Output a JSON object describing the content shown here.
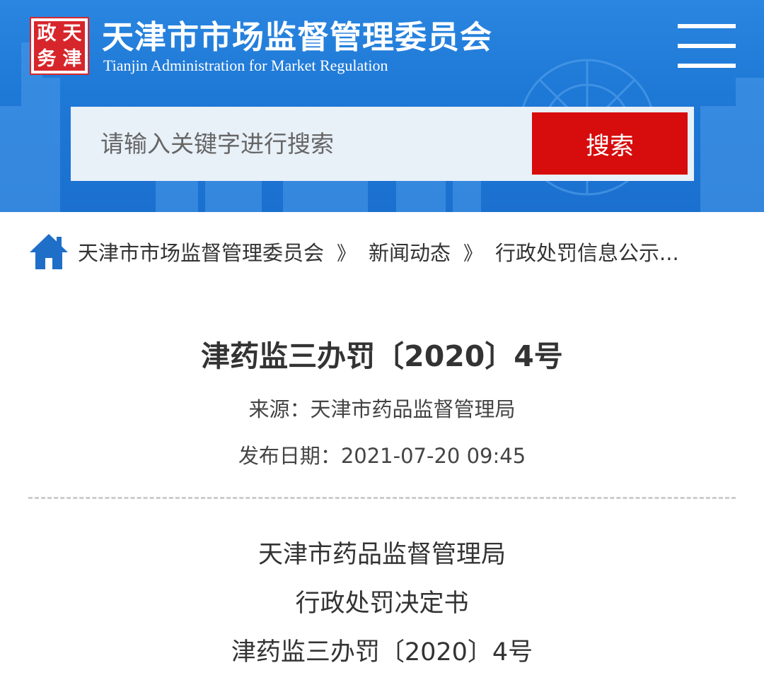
{
  "header": {
    "seal_chars": [
      "政",
      "天",
      "务",
      "津"
    ],
    "title": "天津市市场监督管理委员会",
    "subtitle": "Tianjin Administration for Market Regulation",
    "menu_icon": "hamburger-menu-icon",
    "colors": {
      "background": "#1e78d6",
      "seal": "#d7262b"
    }
  },
  "search": {
    "placeholder": "请输入关键字进行搜索",
    "button_label": "搜索",
    "button_color": "#d70c0c"
  },
  "breadcrumb": {
    "home_icon": "home-icon",
    "items": [
      "天津市市场监督管理委员会",
      "新闻动态",
      "行政处罚信息公示..."
    ],
    "separator": "》"
  },
  "article": {
    "title": "津药监三办罚〔2020〕4号",
    "source": "来源：天津市药品监督管理局",
    "date": "发布日期：2021-07-20 09:45",
    "body_lines": [
      "天津市药品监督管理局",
      "行政处罚决定书",
      "津药监三办罚〔2020〕4号"
    ]
  }
}
